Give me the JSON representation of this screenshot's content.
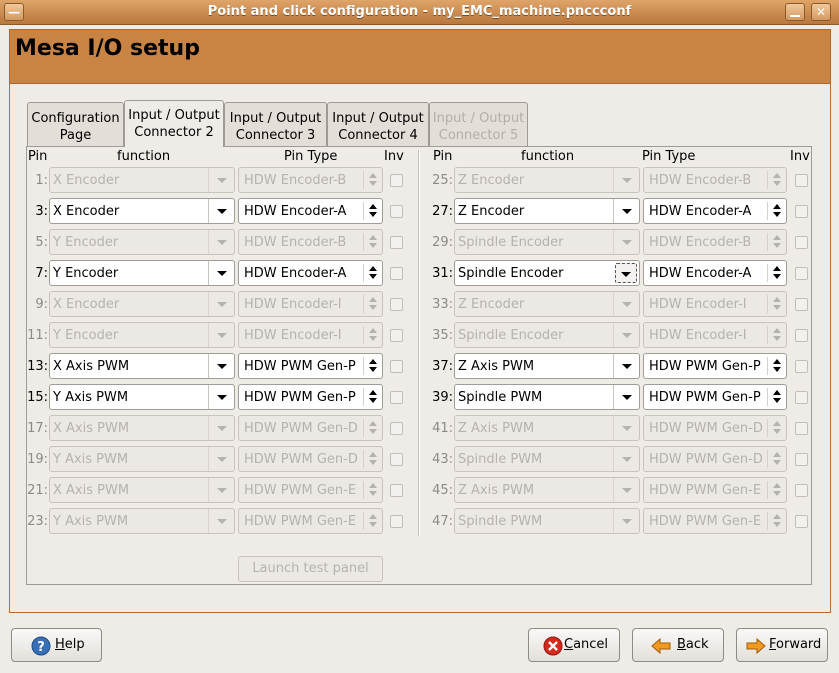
{
  "window": {
    "title": "Point and click configuration - my_EMC_machine.pnccconf",
    "menu_glyph": "—",
    "minimize_glyph": "",
    "close_glyph": "✕"
  },
  "header": {
    "title": "Mesa I/O setup"
  },
  "tabs": [
    {
      "line1": "Configuration",
      "line2": "Page",
      "state": "normal"
    },
    {
      "line1": "Input / Output",
      "line2": "Connector 2",
      "state": "active"
    },
    {
      "line1": "Input / Output",
      "line2": "Connector 3",
      "state": "normal"
    },
    {
      "line1": "Input / Output",
      "line2": "Connector 4",
      "state": "normal"
    },
    {
      "line1": "Input / Output",
      "line2": "Connector 5",
      "state": "disabled"
    }
  ],
  "columns": {
    "pin": "Pin",
    "function": "function",
    "pin_type": "Pin Type",
    "inv": "Inv"
  },
  "left_rows": [
    {
      "pin": "1:",
      "function": "X Encoder",
      "type": "HDW Encoder-B",
      "enabled": false
    },
    {
      "pin": "3:",
      "function": "X Encoder",
      "type": "HDW Encoder-A",
      "enabled": true
    },
    {
      "pin": "5:",
      "function": "Y Encoder",
      "type": "HDW Encoder-B",
      "enabled": false
    },
    {
      "pin": "7:",
      "function": "Y Encoder",
      "type": "HDW Encoder-A",
      "enabled": true
    },
    {
      "pin": "9:",
      "function": "X Encoder",
      "type": "HDW Encoder-I",
      "enabled": false
    },
    {
      "pin": "11:",
      "function": "Y Encoder",
      "type": "HDW Encoder-I",
      "enabled": false
    },
    {
      "pin": "13:",
      "function": "X Axis PWM",
      "type": "HDW PWM Gen-P",
      "enabled": true
    },
    {
      "pin": "15:",
      "function": "Y Axis PWM",
      "type": "HDW PWM Gen-P",
      "enabled": true
    },
    {
      "pin": "17:",
      "function": "X Axis PWM",
      "type": "HDW PWM Gen-D",
      "enabled": false
    },
    {
      "pin": "19:",
      "function": "Y Axis PWM",
      "type": "HDW PWM Gen-D",
      "enabled": false
    },
    {
      "pin": "21:",
      "function": "X Axis PWM",
      "type": "HDW PWM Gen-E",
      "enabled": false
    },
    {
      "pin": "23:",
      "function": "Y Axis PWM",
      "type": "HDW PWM Gen-E",
      "enabled": false
    }
  ],
  "right_rows": [
    {
      "pin": "25:",
      "function": "Z Encoder",
      "type": "HDW Encoder-B",
      "enabled": false
    },
    {
      "pin": "27:",
      "function": "Z Encoder",
      "type": "HDW Encoder-A",
      "enabled": true
    },
    {
      "pin": "29:",
      "function": "Spindle Encoder",
      "type": "HDW Encoder-B",
      "enabled": false
    },
    {
      "pin": "31:",
      "function": "Spindle Encoder",
      "type": "HDW Encoder-A",
      "enabled": true,
      "focused": true
    },
    {
      "pin": "33:",
      "function": "Z Encoder",
      "type": "HDW Encoder-I",
      "enabled": false
    },
    {
      "pin": "35:",
      "function": "Spindle Encoder",
      "type": "HDW Encoder-I",
      "enabled": false
    },
    {
      "pin": "37:",
      "function": "Z Axis PWM",
      "type": "HDW PWM Gen-P",
      "enabled": true
    },
    {
      "pin": "39:",
      "function": "Spindle PWM",
      "type": "HDW PWM Gen-P",
      "enabled": true
    },
    {
      "pin": "41:",
      "function": "Z Axis PWM",
      "type": "HDW PWM Gen-D",
      "enabled": false
    },
    {
      "pin": "43:",
      "function": "Spindle PWM",
      "type": "HDW PWM Gen-D",
      "enabled": false
    },
    {
      "pin": "45:",
      "function": "Z Axis PWM",
      "type": "HDW PWM Gen-E",
      "enabled": false
    },
    {
      "pin": "47:",
      "function": "Spindle PWM",
      "type": "HDW PWM Gen-E",
      "enabled": false
    }
  ],
  "launch_button": "Launch test panel",
  "buttons": {
    "help": {
      "mnemonic": "H",
      "rest": "elp"
    },
    "cancel": {
      "mnemonic": "C",
      "rest": "ancel"
    },
    "back": {
      "mnemonic": "B",
      "rest": "ack"
    },
    "forward": {
      "mnemonic": "F",
      "rest": "orward"
    }
  },
  "colors": {
    "accent": "#c98443",
    "title_bar": "#b8773e",
    "help_icon": "#3a6fb5",
    "cancel_icon": "#d42a1e",
    "arrow_icon": "#f09a20"
  }
}
